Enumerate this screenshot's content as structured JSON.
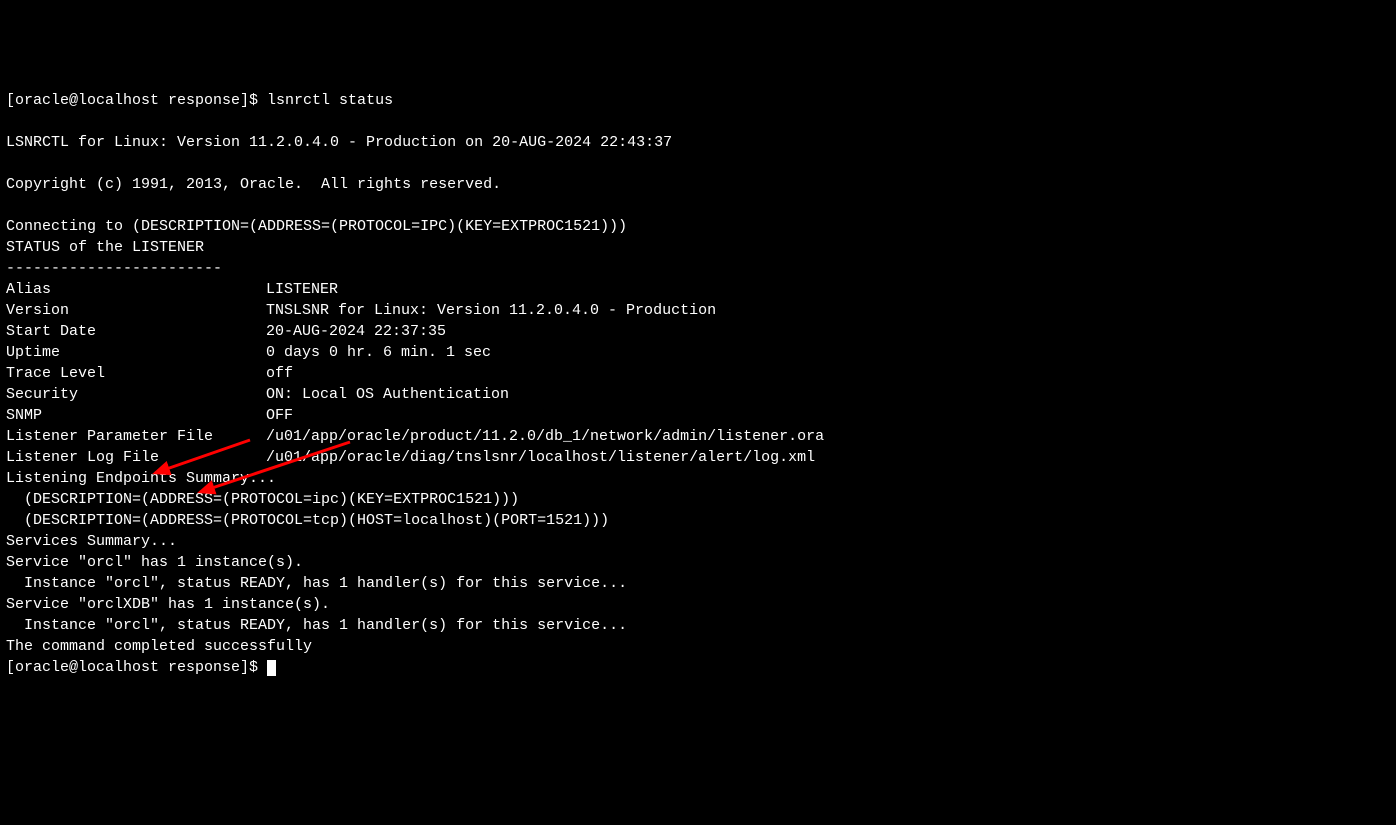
{
  "prompt1": {
    "prefix": "[oracle@localhost response]$ ",
    "command": "lsnrctl status"
  },
  "blank1": "",
  "version_line": "LSNRCTL for Linux: Version 11.2.0.4.0 - Production on 20-AUG-2024 22:43:37",
  "blank2": "",
  "copyright_line": "Copyright (c) 1991, 2013, Oracle.  All rights reserved.",
  "blank3": "",
  "connecting_line": "Connecting to (DESCRIPTION=(ADDRESS=(PROTOCOL=IPC)(KEY=EXTPROC1521)))",
  "status_header": "STATUS of the LISTENER",
  "sep_line": "------------------------",
  "fields": {
    "alias": {
      "label": "Alias",
      "value": "LISTENER"
    },
    "version": {
      "label": "Version",
      "value": "TNSLSNR for Linux: Version 11.2.0.4.0 - Production"
    },
    "start_date": {
      "label": "Start Date",
      "value": "20-AUG-2024 22:37:35"
    },
    "uptime": {
      "label": "Uptime",
      "value": "0 days 0 hr. 6 min. 1 sec"
    },
    "trace": {
      "label": "Trace Level",
      "value": "off"
    },
    "security": {
      "label": "Security",
      "value": "ON: Local OS Authentication"
    },
    "snmp": {
      "label": "SNMP",
      "value": "OFF"
    },
    "param_file": {
      "label": "Listener Parameter File",
      "value": "/u01/app/oracle/product/11.2.0/db_1/network/admin/listener.ora"
    },
    "log_file": {
      "label": "Listener Log File",
      "value": "/u01/app/oracle/diag/tnslsnr/localhost/listener/alert/log.xml"
    }
  },
  "endpoints_header": "Listening Endpoints Summary...",
  "endpoint1": "  (DESCRIPTION=(ADDRESS=(PROTOCOL=ipc)(KEY=EXTPROC1521)))",
  "endpoint2": "  (DESCRIPTION=(ADDRESS=(PROTOCOL=tcp)(HOST=localhost)(PORT=1521)))",
  "services_header": "Services Summary...",
  "service1": "Service \"orcl\" has 1 instance(s).",
  "instance1": "  Instance \"orcl\", status READY, has 1 handler(s) for this service...",
  "service2": "Service \"orclXDB\" has 1 instance(s).",
  "instance2": "  Instance \"orcl\", status READY, has 1 handler(s) for this service...",
  "completed": "The command completed successfully",
  "prompt2": {
    "prefix": "[oracle@localhost response]$ "
  }
}
